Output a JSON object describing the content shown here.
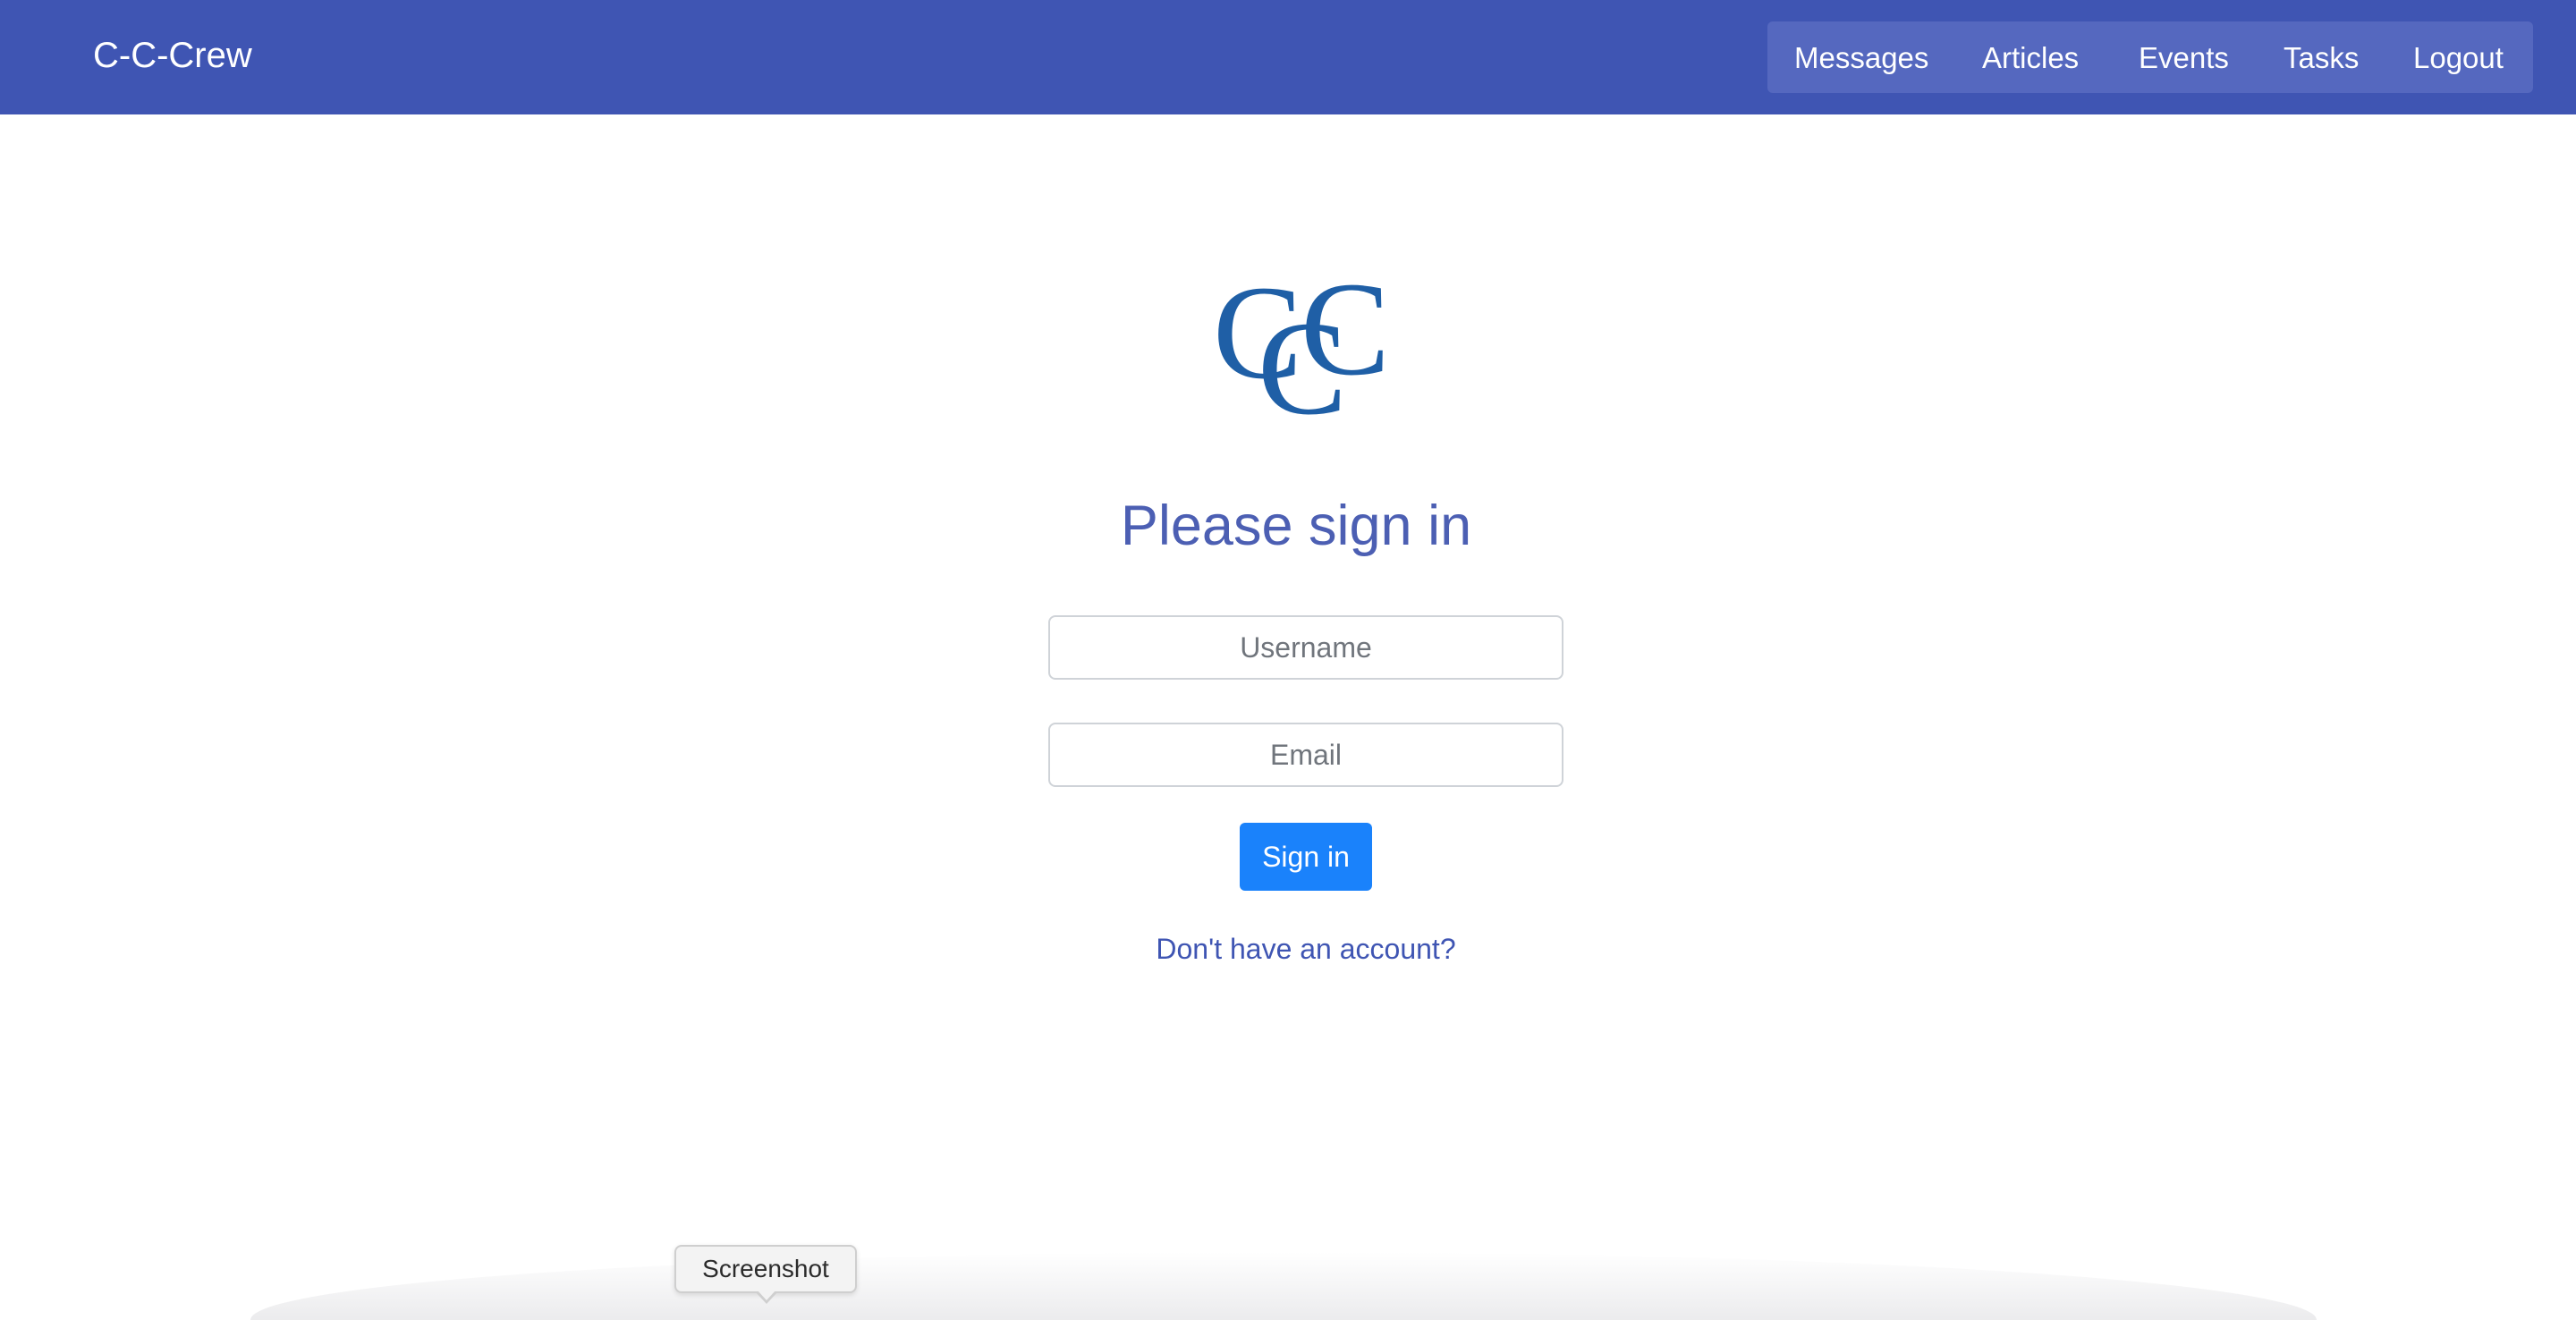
{
  "navbar": {
    "brand": "C-C-Crew",
    "links": [
      "Messages",
      "Articles",
      "Events",
      "Tasks",
      "Logout"
    ]
  },
  "logo": {
    "text": "CCC"
  },
  "signin": {
    "title": "Please sign in",
    "username_placeholder": "Username",
    "email_placeholder": "Email",
    "submit_label": "Sign in",
    "register_link": "Don't have an account?"
  },
  "tooltip": {
    "label": "Screenshot"
  },
  "colors": {
    "navbar": "#3f55b3",
    "nav_pill": "#5568bf",
    "title": "#4c5fb3",
    "logo": "#1f5fa6",
    "button": "#1a82fb",
    "link": "#3f55b3"
  }
}
